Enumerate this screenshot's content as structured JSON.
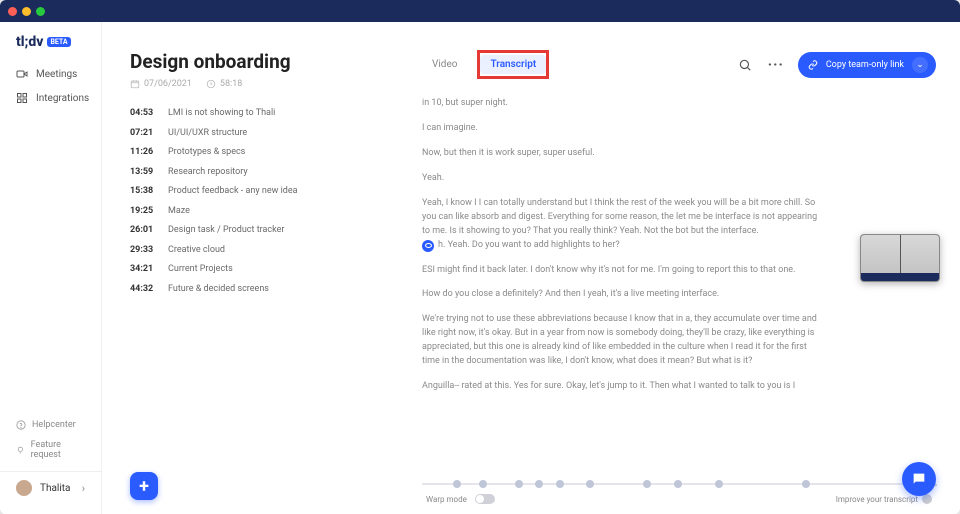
{
  "brand": {
    "name": "tl;dv",
    "badge": "BETA"
  },
  "sidebar": {
    "items": [
      {
        "label": "Meetings",
        "icon": "video-icon"
      },
      {
        "label": "Integrations",
        "icon": "grid-icon"
      }
    ],
    "help": "Helpcenter",
    "feature": "Feature request",
    "user": "Thalita"
  },
  "page": {
    "title": "Design onboarding",
    "date": "07/06/2021",
    "duration": "58:18"
  },
  "markers": [
    {
      "time": "04:53",
      "label": "LMI is not showing to Thali"
    },
    {
      "time": "07:21",
      "label": "UI/UI/UXR structure"
    },
    {
      "time": "11:26",
      "label": "Prototypes & specs"
    },
    {
      "time": "13:59",
      "label": "Research repository"
    },
    {
      "time": "15:38",
      "label": "Product feedback - any new idea"
    },
    {
      "time": "19:25",
      "label": "Maze"
    },
    {
      "time": "26:01",
      "label": "Design task / Product tracker"
    },
    {
      "time": "29:33",
      "label": "Creative cloud"
    },
    {
      "time": "34:21",
      "label": "Current Projects"
    },
    {
      "time": "44:32",
      "label": "Future & decided screens"
    }
  ],
  "tabs": {
    "video": "Video",
    "transcript": "Transcript"
  },
  "copy_button": "Copy team-only link",
  "transcript": {
    "lines": [
      "in 10, but super night.",
      "I can imagine.",
      "Now, but then it is work super, super useful.",
      "Yeah."
    ],
    "block1_a": "Yeah, I know I I can totally understand but I think the rest of the week you will be a bit more chill. So you can like absorb and digest. Everything for some reason, the let me be interface is not appearing to me. Is it showing to you? That you really think? Yeah. Not the bot but the interface.",
    "block1_b": "h. Yeah. Do you want to add highlights to her?",
    "block2": "ESI might find it back later. I don't know why it's not for me. I'm going to report this to that one.",
    "block3": "How do you close a definitely? And then I yeah, it's a live meeting interface.",
    "block4": "We're trying not to use these abbreviations because I know that in a, they accumulate over time and like right now, it's okay. But in a year from now is somebody doing, they'll be crazy, like everything is appreciated, but this one is already kind of like embedded in the culture when I read it for the first time in the documentation was like, I don't know, what does it mean? But what is it?",
    "block5": "Anguilla-- rated at this. Yes for sure. Okay, let's jump to it. Then what I wanted to talk to you is I"
  },
  "footer": {
    "warp": "Warp mode",
    "improve": "Improve your transcript"
  }
}
